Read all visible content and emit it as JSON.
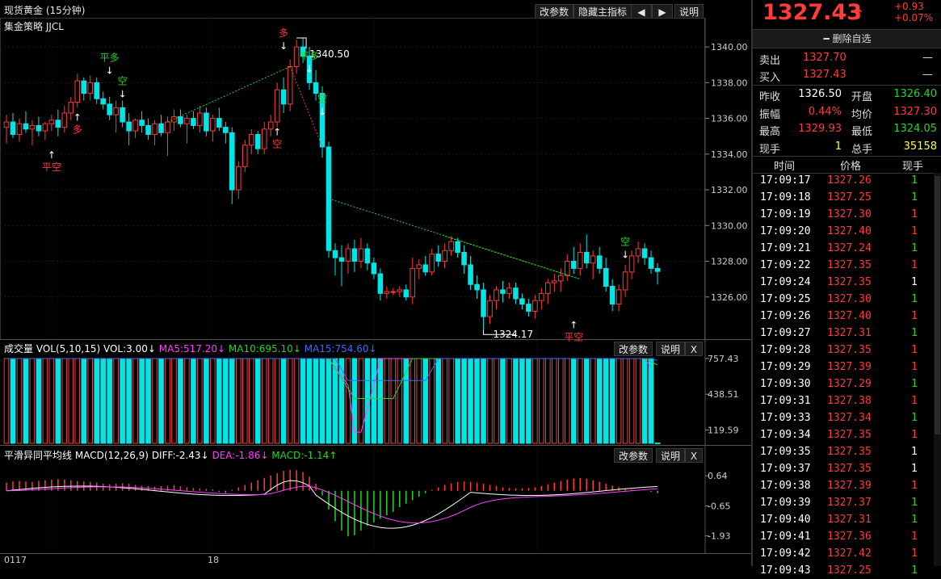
{
  "window": {
    "title": "现货黄金 (15分钟)",
    "strategy": "集金策略 JJCL"
  },
  "toolbar": {
    "params_label": "改参数",
    "hide_label": "隐藏主指标",
    "prev_icon": "left-arrow-icon",
    "next_icon": "right-arrow-icon",
    "help_label": "说明"
  },
  "price_panel": {
    "y_ticks": [
      "1340.00",
      "1338.00",
      "1336.00",
      "1334.00",
      "1332.00",
      "1330.00",
      "1328.00",
      "1326.00"
    ],
    "high_label": "1340.50",
    "low_label": "1324.17",
    "signals": [
      {
        "text": "平空",
        "color": "red"
      },
      {
        "text": "多",
        "color": "red"
      },
      {
        "text": "平多",
        "color": "green"
      },
      {
        "text": "空",
        "color": "green"
      },
      {
        "text": "多",
        "color": "red"
      },
      {
        "text": "空",
        "color": "red"
      },
      {
        "text": "平多",
        "color": "green"
      },
      {
        "text": "空",
        "color": "green"
      },
      {
        "text": "平空",
        "color": "red"
      },
      {
        "text": "空",
        "color": "green"
      }
    ]
  },
  "volume_panel": {
    "title": "成交量",
    "vol": "VOL(5,10,15)",
    "vol_value": "VOL:3.00↓",
    "ma5": "MA5:517.20↓",
    "ma10": "MA10:695.10↓",
    "ma15": "MA15:754.60↓",
    "y_ticks": [
      "757.43",
      "438.51",
      "119.59"
    ],
    "params_label": "改参数",
    "help_label": "说明",
    "close_label": "X"
  },
  "macd_panel": {
    "title": "平滑异同平均线",
    "macd": "MACD(12,26,9)",
    "diff": "DIFF:-2.43↓",
    "dea": "DEA:-1.86↓",
    "macd_value": "MACD:-1.14↑",
    "y_ticks": [
      "0.64",
      "-0.65",
      "-1.93"
    ],
    "params_label": "改参数",
    "help_label": "说明",
    "close_label": "X"
  },
  "x_axis": {
    "labels": [
      "0117",
      "18"
    ]
  },
  "quote": {
    "last_price": "1327.43",
    "change": "+0.93",
    "change_pct": "+0.07%",
    "delete_label": "删除自选",
    "sell_label": "卖出",
    "sell_price": "1327.70",
    "sell_qty": "—",
    "buy_label": "买入",
    "buy_price": "1327.43",
    "buy_qty": "—",
    "stats": [
      {
        "l1": "昨收",
        "v1": "1326.50",
        "c1": "white",
        "l2": "开盘",
        "v2": "1326.40",
        "c2": "green"
      },
      {
        "l1": "振幅",
        "v1": "0.44%",
        "c1": "red",
        "l2": "均价",
        "v2": "1327.30",
        "c2": "red"
      },
      {
        "l1": "最高",
        "v1": "1329.93",
        "c1": "red",
        "l2": "最低",
        "v2": "1324.05",
        "c2": "green"
      },
      {
        "l1": "现手",
        "v1": "1",
        "c1": "yellow",
        "l2": "总手",
        "v2": "35158",
        "c2": "yellow"
      }
    ],
    "ticks_header": {
      "time": "时间",
      "price": "价格",
      "qty": "现手"
    },
    "ticks": [
      {
        "time": "17:09:17",
        "price": "1327.26",
        "qty": "1",
        "c": "green"
      },
      {
        "time": "17:09:18",
        "price": "1327.25",
        "qty": "1",
        "c": "green"
      },
      {
        "time": "17:09:19",
        "price": "1327.30",
        "qty": "1",
        "c": "red"
      },
      {
        "time": "17:09:20",
        "price": "1327.40",
        "qty": "1",
        "c": "red"
      },
      {
        "time": "17:09:21",
        "price": "1327.24",
        "qty": "1",
        "c": "green"
      },
      {
        "time": "17:09:22",
        "price": "1327.35",
        "qty": "1",
        "c": "red"
      },
      {
        "time": "17:09:24",
        "price": "1327.35",
        "qty": "1",
        "c": "white"
      },
      {
        "time": "17:09:25",
        "price": "1327.30",
        "qty": "1",
        "c": "green"
      },
      {
        "time": "17:09:26",
        "price": "1327.40",
        "qty": "1",
        "c": "red"
      },
      {
        "time": "17:09:27",
        "price": "1327.31",
        "qty": "1",
        "c": "green"
      },
      {
        "time": "17:09:28",
        "price": "1327.35",
        "qty": "1",
        "c": "red"
      },
      {
        "time": "17:09:29",
        "price": "1327.39",
        "qty": "1",
        "c": "red"
      },
      {
        "time": "17:09:30",
        "price": "1327.29",
        "qty": "1",
        "c": "green"
      },
      {
        "time": "17:09:31",
        "price": "1327.38",
        "qty": "1",
        "c": "red"
      },
      {
        "time": "17:09:33",
        "price": "1327.34",
        "qty": "1",
        "c": "green"
      },
      {
        "time": "17:09:34",
        "price": "1327.35",
        "qty": "1",
        "c": "red"
      },
      {
        "time": "17:09:35",
        "price": "1327.35",
        "qty": "1",
        "c": "white"
      },
      {
        "time": "17:09:37",
        "price": "1327.35",
        "qty": "1",
        "c": "white"
      },
      {
        "time": "17:09:38",
        "price": "1327.39",
        "qty": "1",
        "c": "red"
      },
      {
        "time": "17:09:39",
        "price": "1327.37",
        "qty": "1",
        "c": "green"
      },
      {
        "time": "17:09:40",
        "price": "1327.31",
        "qty": "1",
        "c": "green"
      },
      {
        "time": "17:09:41",
        "price": "1327.36",
        "qty": "1",
        "c": "red"
      },
      {
        "time": "17:09:42",
        "price": "1327.42",
        "qty": "1",
        "c": "red"
      },
      {
        "time": "17:09:43",
        "price": "1327.25",
        "qty": "1",
        "c": "green"
      }
    ]
  },
  "colors": {
    "up": "#ff3b3b",
    "down": "#00e5e5",
    "green": "#25d425",
    "ma5": "#ffffff",
    "ma10": "#ff40ff",
    "ma15": "#3b6bff",
    "bg": "#000000"
  },
  "chart_data": {
    "type": "candlestick",
    "title": "现货黄金 (15分钟)",
    "ylim": [
      1324,
      1341
    ],
    "ohlc": [
      [
        1335.5,
        1336.2,
        1334.6,
        1335.8
      ],
      [
        1335.8,
        1336.3,
        1334.9,
        1335.1
      ],
      [
        1335.1,
        1336.0,
        1334.7,
        1335.7
      ],
      [
        1335.7,
        1336.4,
        1335.2,
        1335.4
      ],
      [
        1335.4,
        1335.9,
        1334.5,
        1335.6
      ],
      [
        1335.6,
        1336.1,
        1335.0,
        1335.3
      ],
      [
        1335.3,
        1335.8,
        1334.8,
        1335.7
      ],
      [
        1335.7,
        1336.2,
        1335.3,
        1335.9
      ],
      [
        1335.9,
        1336.5,
        1335.0,
        1335.5
      ],
      [
        1335.5,
        1336.7,
        1335.2,
        1336.3
      ],
      [
        1336.3,
        1337.2,
        1335.9,
        1336.9
      ],
      [
        1336.9,
        1338.5,
        1336.6,
        1338.1
      ],
      [
        1338.1,
        1338.3,
        1337.0,
        1337.4
      ],
      [
        1337.4,
        1338.4,
        1337.0,
        1338.0
      ],
      [
        1338.0,
        1338.3,
        1336.8,
        1337.1
      ],
      [
        1337.1,
        1337.5,
        1336.5,
        1336.8
      ],
      [
        1336.8,
        1337.2,
        1335.9,
        1336.2
      ],
      [
        1336.2,
        1337.0,
        1335.2,
        1336.6
      ],
      [
        1336.6,
        1337.0,
        1335.5,
        1335.8
      ],
      [
        1335.8,
        1336.3,
        1334.5,
        1335.3
      ],
      [
        1335.3,
        1336.0,
        1334.9,
        1335.9
      ],
      [
        1335.9,
        1336.4,
        1335.2,
        1335.6
      ],
      [
        1335.6,
        1336.0,
        1334.8,
        1335.1
      ],
      [
        1335.1,
        1335.9,
        1334.5,
        1335.7
      ],
      [
        1335.7,
        1336.2,
        1335.0,
        1335.2
      ],
      [
        1335.2,
        1336.1,
        1333.9,
        1335.8
      ],
      [
        1335.8,
        1336.5,
        1335.3,
        1336.1
      ],
      [
        1336.1,
        1336.5,
        1335.5,
        1335.7
      ],
      [
        1335.7,
        1336.2,
        1334.6,
        1336.0
      ],
      [
        1336.0,
        1336.4,
        1335.4,
        1335.6
      ],
      [
        1335.6,
        1336.7,
        1335.2,
        1336.3
      ],
      [
        1336.3,
        1336.6,
        1335.0,
        1335.3
      ],
      [
        1335.3,
        1336.2,
        1334.7,
        1336.0
      ],
      [
        1336.0,
        1336.6,
        1335.3,
        1335.5
      ],
      [
        1335.5,
        1335.8,
        1334.6,
        1335.2
      ],
      [
        1335.2,
        1335.5,
        1331.2,
        1332.0
      ],
      [
        1332.0,
        1333.6,
        1331.5,
        1333.3
      ],
      [
        1333.3,
        1334.8,
        1333.0,
        1334.5
      ],
      [
        1334.5,
        1335.4,
        1334.0,
        1335.1
      ],
      [
        1335.1,
        1335.3,
        1334.0,
        1334.3
      ],
      [
        1334.3,
        1335.8,
        1334.0,
        1335.4
      ],
      [
        1335.4,
        1336.2,
        1335.0,
        1335.8
      ],
      [
        1335.8,
        1338.0,
        1335.5,
        1337.6
      ],
      [
        1337.6,
        1338.3,
        1336.3,
        1336.8
      ],
      [
        1336.8,
        1339.3,
        1336.4,
        1338.9
      ],
      [
        1338.9,
        1340.4,
        1338.5,
        1340.0
      ],
      [
        1340.0,
        1340.5,
        1339.1,
        1339.5
      ],
      [
        1339.5,
        1340.0,
        1337.6,
        1338.0
      ],
      [
        1338.0,
        1338.7,
        1337.0,
        1337.4
      ],
      [
        1337.4,
        1337.8,
        1333.8,
        1334.4
      ],
      [
        1334.4,
        1334.7,
        1328.2,
        1328.6
      ],
      [
        1328.6,
        1329.0,
        1327.2,
        1328.2
      ],
      [
        1328.2,
        1328.9,
        1326.6,
        1328.0
      ],
      [
        1328.0,
        1329.0,
        1327.3,
        1328.7
      ],
      [
        1328.7,
        1329.2,
        1327.4,
        1328.0
      ],
      [
        1328.0,
        1329.3,
        1327.6,
        1328.7
      ],
      [
        1328.7,
        1329.0,
        1327.5,
        1327.9
      ],
      [
        1327.9,
        1328.2,
        1327.0,
        1327.3
      ],
      [
        1327.3,
        1327.6,
        1325.8,
        1326.2
      ],
      [
        1326.2,
        1326.6,
        1325.9,
        1326.3
      ],
      [
        1326.3,
        1326.5,
        1326.1,
        1326.3
      ],
      [
        1326.3,
        1326.6,
        1326.0,
        1326.4
      ],
      [
        1326.4,
        1326.7,
        1325.8,
        1326.0
      ],
      [
        1326.0,
        1328.2,
        1325.6,
        1327.6
      ],
      [
        1327.6,
        1328.1,
        1327.0,
        1327.8
      ],
      [
        1327.8,
        1328.3,
        1327.2,
        1327.4
      ],
      [
        1327.4,
        1328.7,
        1327.2,
        1328.4
      ],
      [
        1328.4,
        1328.9,
        1327.7,
        1328.0
      ],
      [
        1328.0,
        1329.0,
        1327.6,
        1328.6
      ],
      [
        1328.6,
        1329.4,
        1328.3,
        1329.1
      ],
      [
        1329.1,
        1329.3,
        1328.2,
        1328.5
      ],
      [
        1328.5,
        1328.9,
        1327.3,
        1327.8
      ],
      [
        1327.8,
        1328.3,
        1326.4,
        1326.7
      ],
      [
        1326.7,
        1327.2,
        1325.9,
        1326.4
      ],
      [
        1326.4,
        1326.8,
        1324.17,
        1324.9
      ],
      [
        1324.9,
        1326.1,
        1324.5,
        1325.8
      ],
      [
        1325.8,
        1326.6,
        1325.3,
        1326.4
      ],
      [
        1326.4,
        1326.9,
        1325.7,
        1326.2
      ],
      [
        1326.2,
        1326.8,
        1325.9,
        1326.5
      ],
      [
        1326.5,
        1326.8,
        1325.6,
        1325.9
      ],
      [
        1325.9,
        1326.2,
        1325.3,
        1325.6
      ],
      [
        1325.6,
        1325.9,
        1324.9,
        1325.2
      ],
      [
        1325.2,
        1326.1,
        1324.8,
        1325.8
      ],
      [
        1325.8,
        1326.5,
        1325.3,
        1326.2
      ],
      [
        1326.2,
        1327.0,
        1325.6,
        1326.8
      ],
      [
        1326.8,
        1327.3,
        1326.3,
        1326.9
      ],
      [
        1326.9,
        1327.6,
        1326.3,
        1327.2
      ],
      [
        1327.2,
        1328.4,
        1326.9,
        1328.0
      ],
      [
        1328.0,
        1328.8,
        1327.3,
        1327.6
      ],
      [
        1327.6,
        1329.0,
        1327.2,
        1328.5
      ],
      [
        1328.5,
        1329.5,
        1327.6,
        1327.9
      ],
      [
        1327.9,
        1328.6,
        1327.0,
        1328.3
      ],
      [
        1328.3,
        1328.8,
        1327.3,
        1327.6
      ],
      [
        1327.6,
        1328.2,
        1326.3,
        1326.6
      ],
      [
        1326.6,
        1327.0,
        1325.2,
        1325.6
      ],
      [
        1325.6,
        1326.7,
        1325.2,
        1326.4
      ],
      [
        1326.4,
        1327.8,
        1326.0,
        1327.4
      ],
      [
        1327.4,
        1328.6,
        1327.0,
        1328.3
      ],
      [
        1328.3,
        1329.1,
        1327.9,
        1328.7
      ],
      [
        1328.7,
        1329.0,
        1327.8,
        1328.2
      ],
      [
        1328.2,
        1328.6,
        1327.3,
        1327.6
      ],
      [
        1327.6,
        1327.9,
        1326.7,
        1327.43
      ]
    ],
    "volume": [
      757,
      757,
      757,
      757,
      757,
      757,
      757,
      757,
      757,
      757,
      757,
      757,
      757,
      757,
      757,
      757,
      757,
      757,
      757,
      757,
      757,
      757,
      757,
      757,
      757,
      757,
      757,
      757,
      757,
      757,
      757,
      757,
      757,
      757,
      757,
      757,
      757,
      757,
      757,
      757,
      757,
      757,
      757,
      757,
      757,
      757,
      757,
      757,
      757,
      757,
      757,
      757,
      757,
      757,
      757,
      757,
      757,
      757,
      757,
      757,
      757,
      757,
      757,
      757,
      757,
      757,
      757,
      757,
      757,
      757,
      757,
      757,
      757,
      757,
      757,
      757,
      757,
      757,
      757,
      757,
      757,
      757,
      757,
      757,
      757,
      757,
      757,
      757,
      757,
      757,
      757,
      757,
      757,
      757,
      757,
      757,
      757,
      757,
      757,
      757,
      757,
      3
    ],
    "vol_ylim": [
      0,
      800
    ],
    "macd_hist": [
      0.35,
      0.4,
      0.42,
      0.4,
      0.38,
      0.42,
      0.45,
      0.48,
      0.5,
      0.48,
      0.45,
      0.42,
      0.4,
      0.38,
      0.35,
      0.3,
      0.28,
      0.3,
      0.32,
      0.3,
      0.25,
      0.22,
      0.2,
      0.18,
      0.2,
      0.22,
      0.25,
      0.2,
      0.15,
      0.12,
      0.1,
      0.08,
      0.06,
      -0.05,
      -0.1,
      0.05,
      0.15,
      0.25,
      0.35,
      0.45,
      0.55,
      0.65,
      0.75,
      0.85,
      0.9,
      0.88,
      0.8,
      0.6,
      0.3,
      -0.2,
      -0.8,
      -1.3,
      -1.7,
      -1.95,
      -1.9,
      -1.7,
      -1.5,
      -1.35,
      -1.2,
      -1.05,
      -0.9,
      -0.7,
      -0.55,
      -0.4,
      -0.25,
      -0.1,
      0.05,
      0.15,
      0.25,
      0.32,
      0.38,
      0.4,
      0.38,
      0.35,
      0.3,
      0.25,
      0.2,
      0.15,
      0.12,
      0.1,
      0.1,
      0.12,
      0.15,
      0.2,
      0.28,
      0.35,
      0.42,
      0.48,
      0.52,
      0.55,
      0.52,
      0.45,
      0.38,
      0.3,
      0.22,
      0.15,
      0.1,
      0.05,
      0.02,
      0.0,
      -0.05,
      -0.1
    ],
    "macd_ylim": [
      -2.6,
      1.2
    ]
  }
}
